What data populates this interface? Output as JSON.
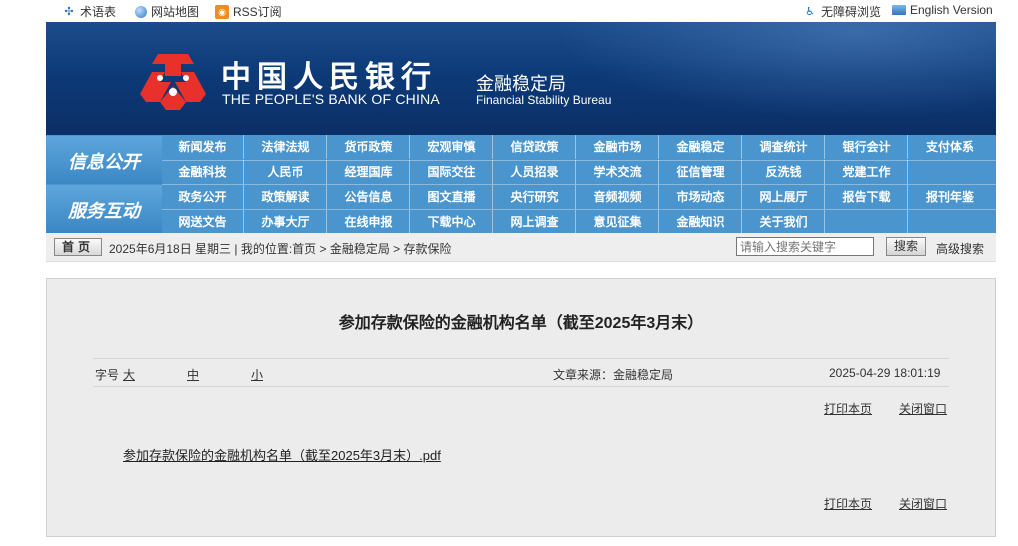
{
  "top_links": {
    "glossary": "术语表",
    "sitemap": "网站地图",
    "rss": "RSS订阅",
    "accessibility": "无障碍浏览",
    "english": "English Version"
  },
  "banner": {
    "bank_cn": "中国人民银行",
    "bank_en": "THE PEOPLE'S BANK OF CHINA",
    "bureau_cn": "金融稳定局",
    "bureau_en": "Financial Stability Bureau"
  },
  "nav": {
    "group1_title": "信息公开",
    "group2_title": "服务互动",
    "rows": [
      [
        "新闻发布",
        "法律法规",
        "货币政策",
        "宏观审慎",
        "信贷政策",
        "金融市场",
        "金融稳定",
        "调查统计",
        "银行会计",
        "支付体系"
      ],
      [
        "金融科技",
        "人民币",
        "经理国库",
        "国际交往",
        "人员招录",
        "学术交流",
        "征信管理",
        "反洗钱",
        "党建工作",
        ""
      ],
      [
        "政务公开",
        "政策解读",
        "公告信息",
        "图文直播",
        "央行研究",
        "音频视频",
        "市场动态",
        "网上展厅",
        "报告下载",
        "报刊年鉴"
      ],
      [
        "网送文告",
        "办事大厅",
        "在线申报",
        "下载中心",
        "网上调查",
        "意见征集",
        "金融知识",
        "关于我们",
        "",
        ""
      ]
    ]
  },
  "breadcrumb": {
    "home": "首页",
    "text": "2025年6月18日 星期三 | 我的位置:首页 > 金融稳定局 > 存款保险",
    "search_placeholder": "请输入搜索关键字",
    "search_button": "搜索",
    "advanced": "高级搜索"
  },
  "article": {
    "title": "参加存款保险的金融机构名单（截至2025年3月末）",
    "font_label": "字号",
    "font_large": "大",
    "font_medium": "中",
    "font_small": "小",
    "source": "文章来源：金融稳定局",
    "datetime": "2025-04-29 18:01:19",
    "print": "打印本页",
    "close": "关闭窗口",
    "attachment": "参加存款保险的金融机构名单（截至2025年3月末）.pdf"
  }
}
